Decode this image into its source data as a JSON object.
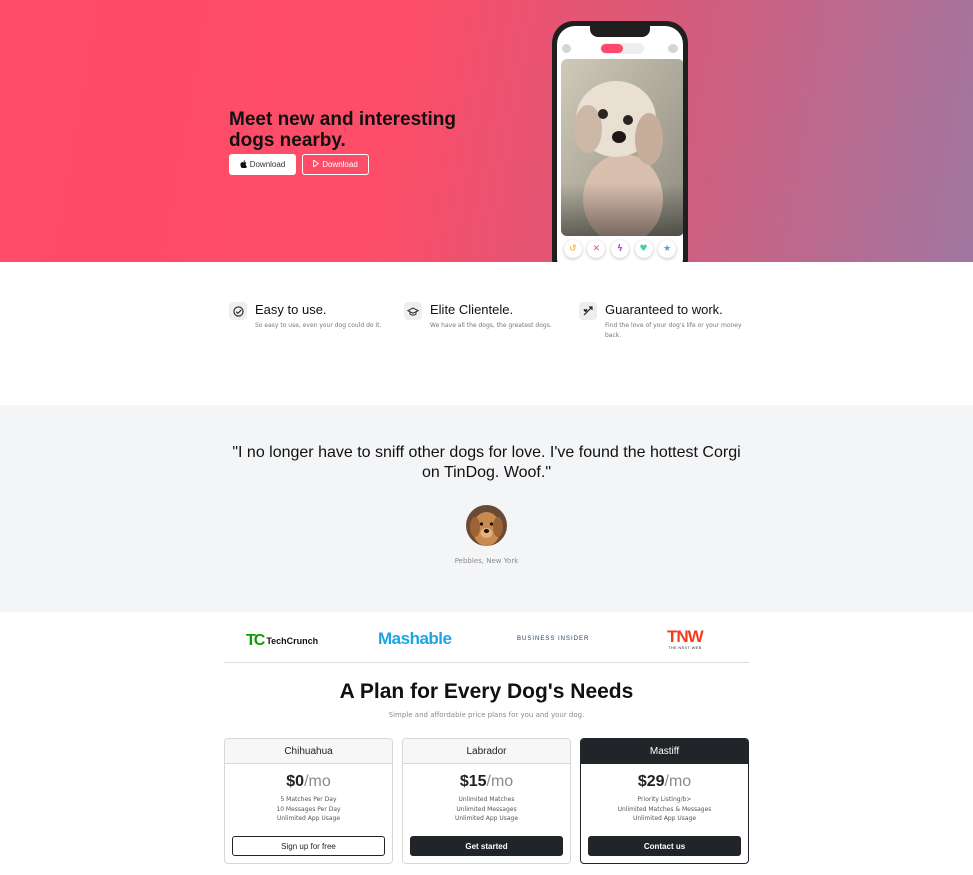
{
  "colors": {
    "hero_start": "#ff4c68",
    "hero_end": "#a077a0",
    "dark": "#212529",
    "accent": "#fe4a6a"
  },
  "hero": {
    "title": "Meet new and interesting dogs nearby.",
    "apple_download_label": "Download",
    "play_download_label": "Download",
    "apple_icon": "apple-icon",
    "play_icon": "google-play-icon"
  },
  "features": [
    {
      "icon": "check-circle-icon",
      "title": "Easy to use.",
      "text": "So easy to use, even your dog could do it."
    },
    {
      "icon": "bullseye-icon",
      "title": "Elite Clientele.",
      "text": "We have all the dogs, the greatest dogs."
    },
    {
      "icon": "heart-icon",
      "title": "Guaranteed to work.",
      "text": "Find the love of your dog's life or your money back."
    }
  ],
  "testimonial": {
    "quote": "\"I no longer have to sniff other dogs for love. I've found the hottest Corgi on TinDog. Woof.\"",
    "author": "Pebbles, New York"
  },
  "press": {
    "techcrunch_mark": "TC",
    "techcrunch": "TechCrunch",
    "mashable": "Mashable",
    "business_insider": "BUSINESS INSIDER",
    "tnw": "TNW",
    "tnw_sub": "THE NEXT WEB"
  },
  "pricing": {
    "title": "A Plan for Every Dog's Needs",
    "subtitle": "Simple and affordable price plans for you and your dog.",
    "plans": [
      {
        "name": "Chihuahua",
        "price": "$0",
        "per": "/mo",
        "features": [
          "5 Matches Per Day",
          "10 Messages Per Day",
          "Unlimited App Usage"
        ],
        "button": "Sign up for free"
      },
      {
        "name": "Labrador",
        "price": "$15",
        "per": "/mo",
        "features": [
          "Unlimited Matches",
          "Unlimited Messages",
          "Unlimited App Usage"
        ],
        "button": "Get started"
      },
      {
        "name": "Mastiff",
        "price": "$29",
        "per": "/mo",
        "features": [
          "Priority Listing/b>",
          "Unlimited Matches & Messages",
          "Unlimited App Usage"
        ],
        "button": "Contact us"
      }
    ]
  }
}
